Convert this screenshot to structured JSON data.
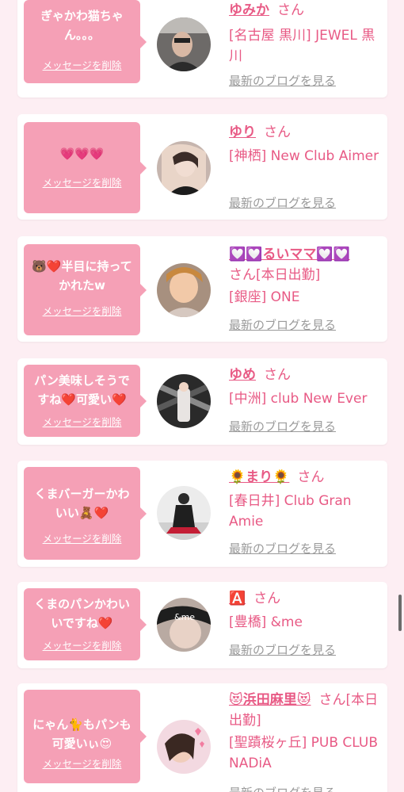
{
  "ui": {
    "delete_label": "メッセージを削除",
    "blog_label": "最新のブログを見る",
    "accent_color": "#e85a85",
    "bubble_color": "#f5a0b6"
  },
  "cards": [
    {
      "message": "ぎゃかわ猫ちゃん。。。",
      "name": "ゆみか",
      "san": "さん",
      "shop": "[名古屋 黒川] JEWEL 黒川",
      "avatar_icon": "girl-photo-icon"
    },
    {
      "message": "💗💗💗",
      "name": "ゆり",
      "san": "さん",
      "shop": "[神栖] New Club Aimer",
      "avatar_icon": "girl-photo-icon"
    },
    {
      "message": "🐻❤️半目に持ってかれたw",
      "name": "💟💟るいママ💟💟",
      "san": "さん[本日出勤]",
      "shop": "[銀座] ONE",
      "avatar_icon": "girl-photo-icon"
    },
    {
      "message": "パン美味しそうですね❤️可愛い❤️",
      "name": "ゆめ",
      "san": "さん",
      "shop": "[中洲] club New Ever",
      "avatar_icon": "girl-photo-icon"
    },
    {
      "message": "くまバーガーかわいい🧸❤️",
      "name": "🌻まり🌻",
      "san": "さん",
      "shop": "[春日井] Club Gran Amie",
      "avatar_icon": "girl-photo-icon"
    },
    {
      "message": "くまのパンかわいいですね❤️",
      "name": "🅰️",
      "san": "さん",
      "shop": "[豊橋] &me",
      "avatar_icon": "girl-photo-icon"
    },
    {
      "message": "にゃん🐈もパンも可愛いぃ😍",
      "name": "😻浜田麻里😻",
      "san": "さん[本日出勤]",
      "shop": "[聖蹟桜ヶ丘] PUB CLUB NADiA",
      "avatar_icon": "girl-photo-icon"
    }
  ]
}
